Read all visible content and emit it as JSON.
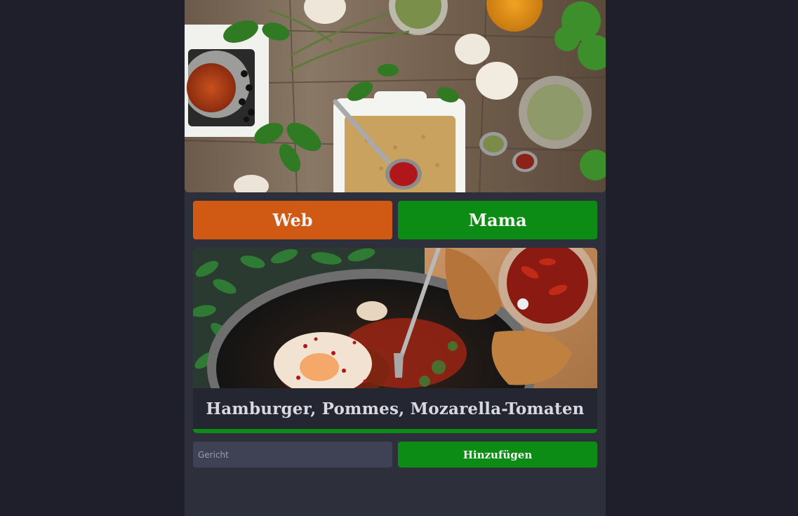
{
  "colors": {
    "page_bg": "#1e1f2a",
    "panel_bg": "#2d2f3b",
    "web_tab": "#d05a14",
    "mama_tab": "#0c8c14",
    "accent_green": "#0c8c14"
  },
  "hero": {
    "image": "spices-and-herbs-photo"
  },
  "tabs": [
    {
      "label": "Web"
    },
    {
      "label": "Mama"
    }
  ],
  "card": {
    "image": "shakshuka-pan-photo",
    "title": "Hamburger,  Pommes,  Mozarella-Tomaten"
  },
  "form": {
    "placeholder": "Gericht",
    "value": "",
    "add_label": "Hinzufügen"
  }
}
